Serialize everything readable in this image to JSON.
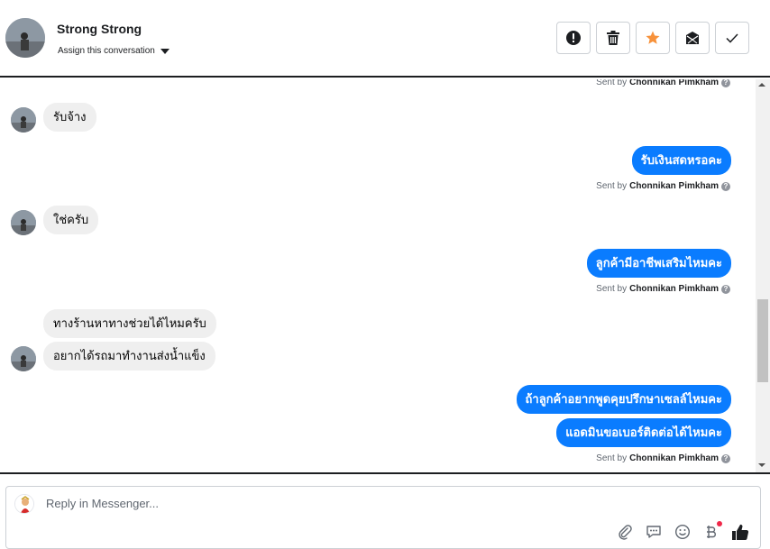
{
  "header": {
    "name": "Strong Strong",
    "assign_label": "Assign this conversation",
    "actions": [
      {
        "icon": "alert-icon"
      },
      {
        "icon": "trash-icon"
      },
      {
        "icon": "star-icon",
        "color": "#f7923b"
      },
      {
        "icon": "mail-blocked-icon"
      },
      {
        "icon": "check-icon"
      }
    ]
  },
  "messages": {
    "sent_by_prefix": "Sent by",
    "agent_name": "Chonnikan Pimkham",
    "m1": "รับจ้าง",
    "m2": "รับเงินสดหรอคะ",
    "m3": "ใช่ครับ",
    "m4": "ลูกค้ามีอาชีพเสริมไหมคะ",
    "m5": "ทางร้านหาทางช่วยได้ไหมครับ",
    "m6": "อยากได้รถมาทำงานส่งน้ำแข็ง",
    "m7": "ถ้าลูกค้าอยากพูดคุยปรึกษาเซลล์ไหมคะ",
    "m8": "แอดมินขอเบอร์ติดต่อได้ไหมคะ"
  },
  "composer": {
    "placeholder": "Reply in Messenger...",
    "tools": [
      "paperclip-icon",
      "saved-reply-icon",
      "emoji-icon",
      "baht-payment-icon",
      "thumbs-up-icon"
    ]
  },
  "colors": {
    "outgoing_bubble": "#0a7cff",
    "incoming_bubble": "#efefef",
    "star": "#f7923b",
    "notification": "#f02849"
  }
}
